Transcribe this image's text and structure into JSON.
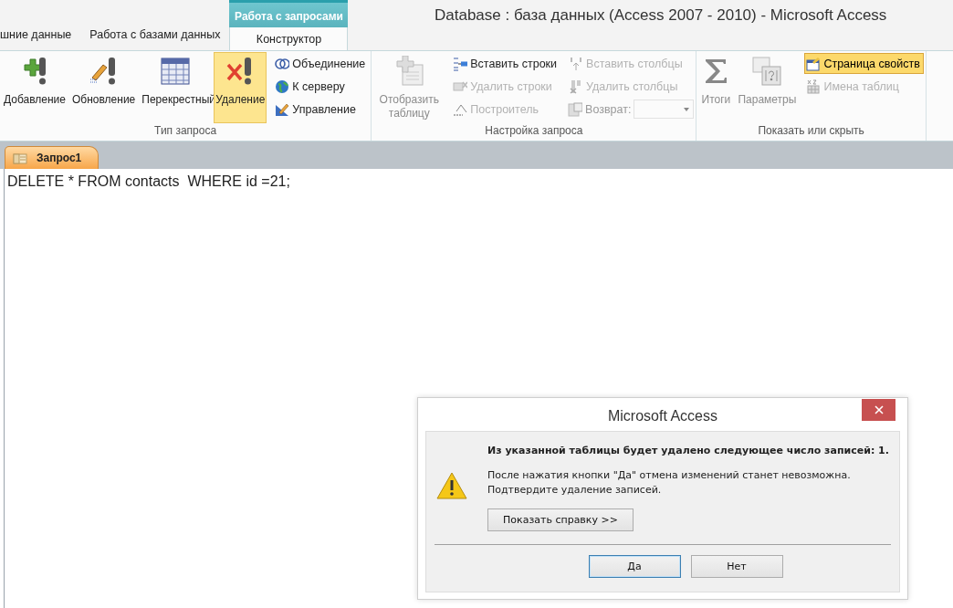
{
  "window": {
    "title": "Database : база данных (Access 2007 - 2010) - Microsoft Access"
  },
  "tabs": [
    {
      "label": "шние данные",
      "selected": false
    },
    {
      "label": "Работа с базами данных",
      "selected": false
    }
  ],
  "contextual_tabs": {
    "header": "Работа с запросами",
    "tabs": [
      {
        "label": "Конструктор",
        "selected": true
      }
    ]
  },
  "ribbon": {
    "groups": [
      {
        "label": "Тип запроса",
        "controls": [
          {
            "kind": "large",
            "label": "Добавление",
            "selected": false,
            "disabled": false
          },
          {
            "kind": "large",
            "label": "Обновление",
            "selected": false,
            "disabled": false
          },
          {
            "kind": "large",
            "label": "Перекрестный",
            "selected": false,
            "disabled": false
          },
          {
            "kind": "large",
            "label": "Удаление",
            "selected": true,
            "disabled": false
          },
          {
            "kind": "stack",
            "items": [
              {
                "kind": "button",
                "label": "Объединение",
                "on": false,
                "disabled": false
              },
              {
                "kind": "button",
                "label": "К серверу",
                "on": false,
                "disabled": false
              },
              {
                "kind": "button",
                "label": "Управление",
                "on": false,
                "disabled": false
              }
            ]
          }
        ]
      },
      {
        "label": "Настройка запроса",
        "controls": [
          {
            "kind": "large",
            "label": "Отобразить таблицу",
            "selected": false,
            "disabled": true
          },
          {
            "kind": "stack",
            "items": [
              {
                "kind": "button",
                "label": "Вставить строки",
                "on": false,
                "disabled": false
              },
              {
                "kind": "button",
                "label": "Удалить строки",
                "on": false,
                "disabled": true
              },
              {
                "kind": "button",
                "label": "Построитель",
                "on": false,
                "disabled": true
              }
            ]
          },
          {
            "kind": "stack",
            "items": [
              {
                "kind": "button",
                "label": "Вставить столбцы",
                "on": false,
                "disabled": true
              },
              {
                "kind": "button",
                "label": "Удалить столбцы",
                "on": false,
                "disabled": true
              },
              {
                "kind": "combo",
                "label": "Возврат:",
                "disabled": true
              }
            ]
          }
        ]
      },
      {
        "label": "Показать или скрыть",
        "controls": [
          {
            "kind": "large",
            "label": "Итоги",
            "selected": false,
            "disabled": true
          },
          {
            "kind": "large",
            "label": "Параметры",
            "selected": false,
            "disabled": true
          },
          {
            "kind": "stack",
            "items": [
              {
                "kind": "button",
                "label": "Страница свойств",
                "on": true,
                "disabled": false
              },
              {
                "kind": "button",
                "label": "Имена таблиц",
                "on": false,
                "disabled": true
              }
            ]
          }
        ]
      }
    ]
  },
  "document_tabs": [
    {
      "label": "Запрос1",
      "selected": true
    }
  ],
  "editor": {
    "text": "DELETE * FROM contacts  WHERE id =21;"
  },
  "dialog": {
    "title": "Microsoft Access",
    "heading": "Из указанной таблицы будет удалено следующее число записей: 1.",
    "lines": [
      "После нажатия кнопки \"Да\" отмена изменений станет невозможна.",
      "Подтвердите удаление записей."
    ],
    "help_button": "Показать справку >>",
    "buttons": [
      {
        "label": "Да",
        "selected": true
      },
      {
        "label": "Нет",
        "selected": false
      }
    ]
  }
}
